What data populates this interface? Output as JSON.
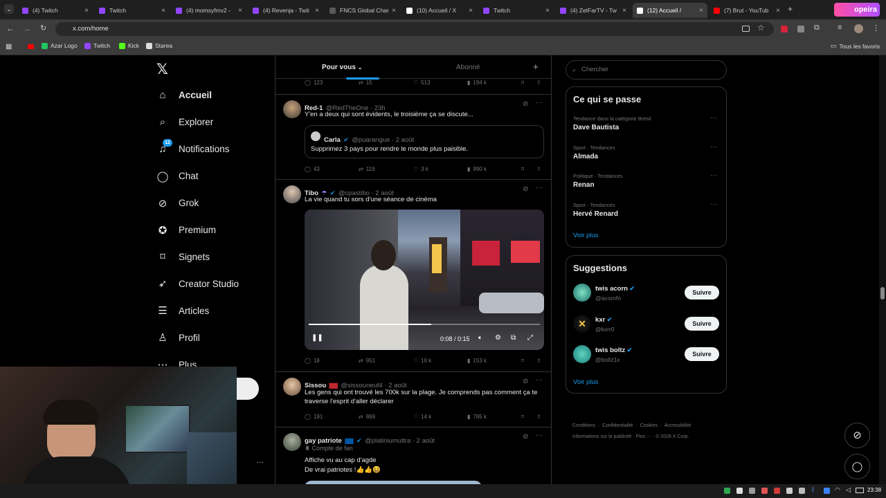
{
  "browser": {
    "tabs": [
      {
        "title": "(4) Twitch",
        "color": "#9146ff"
      },
      {
        "title": "Twitch",
        "color": "#9146ff"
      },
      {
        "title": "(4) momsyfmv2 -",
        "color": "#9146ff"
      },
      {
        "title": "(4) Revenja - Twit",
        "color": "#9146ff"
      },
      {
        "title": "FNCS Global Char",
        "color": "#5a5a5a"
      },
      {
        "title": "(10) Accueil / X",
        "color": "#ffffff"
      },
      {
        "title": "Twitch",
        "color": "#9146ff"
      },
      {
        "title": "(4) ZetFarTV - Tw",
        "color": "#9146ff"
      },
      {
        "title": "(12) Accueil /",
        "color": "#ffffff"
      },
      {
        "title": "(7) Brut - YouTub",
        "color": "#ff0000"
      }
    ],
    "url": "x.com/home",
    "bookmarks": [
      "Azar Logo",
      "Twitch",
      "Kick",
      "Starea"
    ],
    "all_bookmarks": "Tous les favoris",
    "extension_label": "opeira"
  },
  "nav": {
    "items": [
      {
        "label": "Accueil",
        "icon": "home-icon"
      },
      {
        "label": "Explorer",
        "icon": "search-icon"
      },
      {
        "label": "Notifications",
        "icon": "bell-icon",
        "badge": "12"
      },
      {
        "label": "Chat",
        "icon": "chat-icon"
      },
      {
        "label": "Grok",
        "icon": "grok-icon"
      },
      {
        "label": "Premium",
        "icon": "premium-icon"
      },
      {
        "label": "Signets",
        "icon": "bookmark-icon"
      },
      {
        "label": "Creator Studio",
        "icon": "rocket-icon"
      },
      {
        "label": "Articles",
        "icon": "articles-icon"
      },
      {
        "label": "Profil",
        "icon": "profile-icon"
      },
      {
        "label": "Plus",
        "icon": "more-icon"
      }
    ]
  },
  "timeline": {
    "tabs": [
      "Pour vous",
      "Abonné"
    ],
    "top_actions": {
      "replies": "123",
      "reposts": "15",
      "likes": "513",
      "views": "194 k"
    },
    "posts": [
      {
        "name": "Red-1",
        "handle": "@RedTheOne · 23h",
        "text": "Y'en a deux qui sont évidents, le troisième ça se discute...",
        "quote": {
          "name": "Carla",
          "handle": "@puarangue · 2 août",
          "text": "Supprimez 3 pays pour rendre le monde plus paisible."
        },
        "stats": {
          "replies": "43",
          "reposts": "119",
          "likes": "3 k",
          "views": "990 k"
        }
      },
      {
        "name": "Tibo",
        "handle": "@cpastibo · 2 août",
        "text": "La vie quand tu sors d'une séance de cinéma",
        "video": {
          "time": "0:08 / 0:15",
          "progress": 0.53
        },
        "stats": {
          "replies": "18",
          "reposts": "951",
          "likes": "10 k",
          "views": "153 k"
        }
      },
      {
        "name": "Sissou",
        "handle": "@sissouneuf4 · 2 août",
        "text": "Les gens qui ont trouvé les 700k sur la plage. Je comprends pas comment ça te traverse l'esprit d'aller déclarer",
        "stats": {
          "replies": "191",
          "reposts": "869",
          "likes": "14 k",
          "views": "785 k"
        }
      },
      {
        "name": "gay patriote",
        "handle": "@platiniumultra · 2 août",
        "label": "Compte de fan",
        "text": "Affiche vu au cap d'agde",
        "text2": "De vrai patriotes !👍👍😆"
      }
    ]
  },
  "right": {
    "search_placeholder": "Chercher",
    "trends_title": "Ce qui se passe",
    "trends": [
      {
        "sub": "Tendance dans la catégorie Brésil",
        "main": "Dave Bautista"
      },
      {
        "sub": "Sport · Tendances",
        "main": "Almada"
      },
      {
        "sub": "Politique · Tendances",
        "main": "Renan"
      },
      {
        "sub": "Sport · Tendances",
        "main": "Hervé Renard"
      }
    ],
    "see_more": "Voir plus",
    "suggestions_title": "Suggestions",
    "suggestions": [
      {
        "name": "twis acorn",
        "handle": "@acornfn"
      },
      {
        "name": "kxr",
        "handle": "@kxrr0"
      },
      {
        "name": "twis boltz",
        "handle": "@boltz1x"
      }
    ],
    "follow_label": "Suivre",
    "footer_line1": [
      "Conditions",
      "Confidentialité",
      "Cookies",
      "Accessibilité"
    ],
    "footer_line2": "Informations sur la publicité   ·   Plus ···   ·   © 2026 X Corp."
  },
  "taskbar": {
    "time": "23:38"
  },
  "colors": {
    "accent": "#1d9bf0",
    "bg": "#000000",
    "border": "#2f3336",
    "muted": "#71767b"
  }
}
